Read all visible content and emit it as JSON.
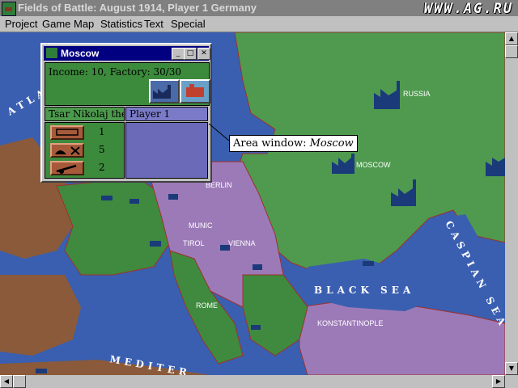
{
  "window": {
    "title": "Fields of Battle: August 1914, Player 1 Germany",
    "watermark": "WWW.AG.RU"
  },
  "menu": {
    "items": [
      "Project",
      "Game",
      "Map",
      "Statistics",
      "Text",
      "Special"
    ]
  },
  "map": {
    "cities": [
      "RUSSIA",
      "MOSCOW",
      "BERLIN",
      "MUNIC",
      "TIROL",
      "VIENNA",
      "ROME",
      "KONSTANTINOPLE"
    ],
    "seas": [
      "BLACK SEA",
      "CASPIAN SEA",
      "ATLA",
      "MEDITER"
    ],
    "colors": {
      "sea": "#3a5fb0",
      "russia": "#4f9a4f",
      "central_powers": "#9c7ab8",
      "neutral": "#8a5a3a",
      "allies_green": "#3f8a3f",
      "borders": "#a0302a"
    }
  },
  "area_window": {
    "title": "Moscow",
    "income_line": "Income: 10, Factory: 30/30",
    "owner_label": "Tsar Nikolaj the",
    "player_label": "Player 1",
    "units": [
      {
        "icon": "infantry-icon",
        "count": "1"
      },
      {
        "icon": "cavalry-icon",
        "count": "5"
      },
      {
        "icon": "artillery-icon",
        "count": "2"
      }
    ],
    "minimize": "_",
    "maximize": "□",
    "close": "✕"
  },
  "callout": {
    "prefix": "Area window: ",
    "name": "Moscow"
  },
  "scrollbar": {
    "up": "▲",
    "down": "▼",
    "left": "◀",
    "right": "▶"
  }
}
